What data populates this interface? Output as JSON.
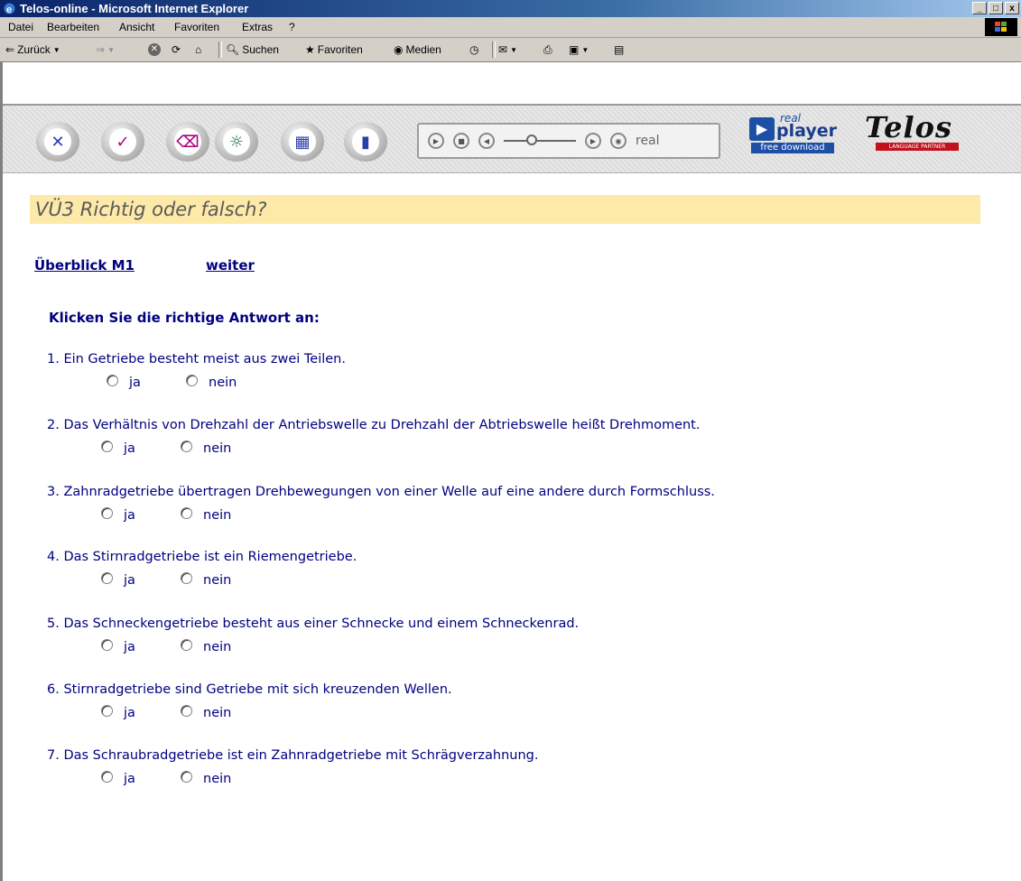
{
  "window": {
    "title": "Telos-online - Microsoft Internet Explorer",
    "buttons": [
      "_",
      "□",
      "x"
    ]
  },
  "menu": [
    "Datei",
    "Bearbeiten",
    "Ansicht",
    "Favoriten",
    "Extras",
    "?"
  ],
  "toolbar": {
    "back": "Zurück",
    "search": "Suchen",
    "favorites": "Favoriten",
    "media": "Medien"
  },
  "player": {
    "label": "real"
  },
  "logos": {
    "realplayer_top": "real",
    "realplayer_main": "player",
    "realplayer_sub": "free download",
    "telos": "Telos",
    "telos_sub": "LANGUAGE PARTNER"
  },
  "page": {
    "heading": "VÜ3 Richtig oder falsch?",
    "nav": {
      "overview": "Überblick M1",
      "next": "weiter"
    },
    "instruction": "Klicken Sie die richtige Antwort an:",
    "option_yes": "ja",
    "option_no": "nein",
    "questions": [
      "1. Ein Getriebe besteht meist aus zwei Teilen.",
      "2. Das Verhältnis von Drehzahl der Antriebswelle zu Drehzahl der Abtriebswelle heißt Drehmoment.",
      "3. Zahnradgetriebe übertragen Drehbewegungen von einer Welle auf eine andere durch Formschluss.",
      "4. Das Stirnradgetriebe ist ein Riemengetriebe.",
      "5. Das Schneckengetriebe besteht aus einer Schnecke und einem Schneckenrad.",
      "6. Stirnradgetriebe sind Getriebe mit sich kreuzenden Wellen.",
      "7. Das Schraubradgetriebe ist ein Zahnradgetriebe mit Schrägverzahnung."
    ]
  }
}
